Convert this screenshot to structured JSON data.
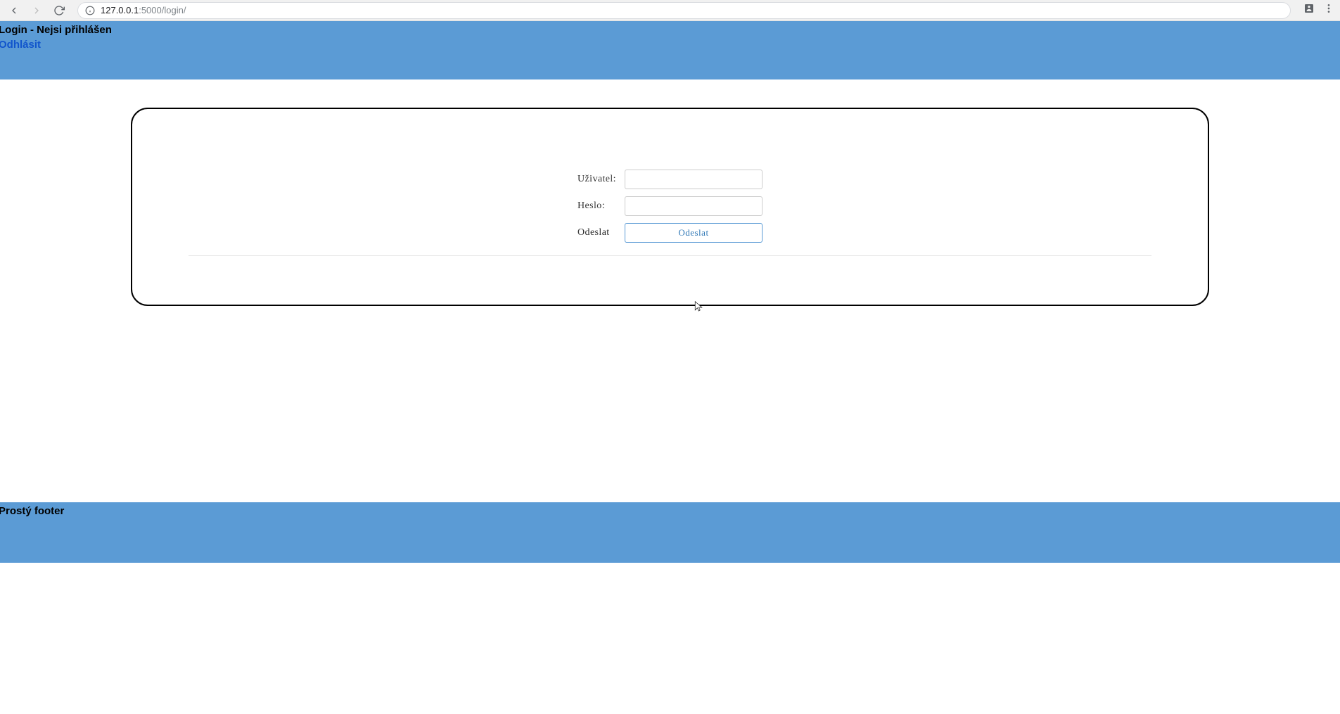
{
  "browser": {
    "url_host": "127.0.0.1",
    "url_port_path": ":5000/login/"
  },
  "header": {
    "title": "Login - Nejsi přihlášen",
    "logout_label": "Odhlásit"
  },
  "form": {
    "user_label": "Uživatel:",
    "user_value": "",
    "password_label": "Heslo:",
    "password_value": "",
    "submit_row_label": "Odeslat",
    "submit_button_label": "Odeslat"
  },
  "footer": {
    "text": "Prostý footer"
  }
}
